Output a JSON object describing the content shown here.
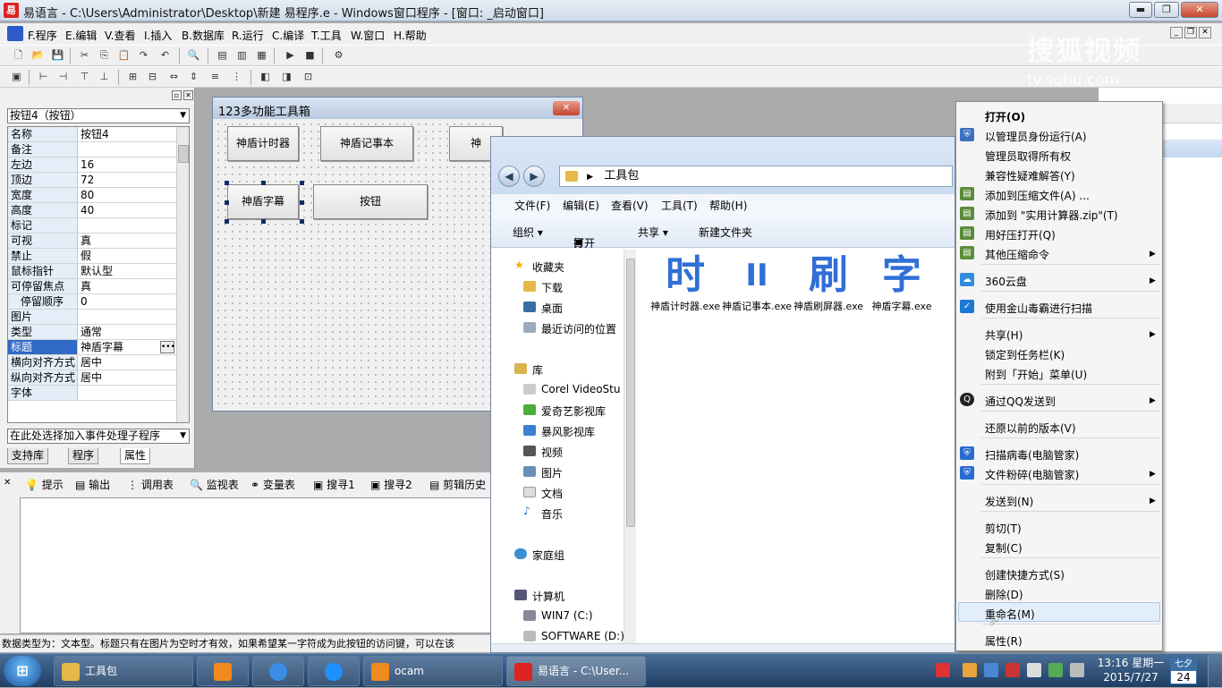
{
  "window": {
    "title": "易语言 - C:\\Users\\Administrator\\Desktop\\新建 易程序.e - Windows窗口程序 - [窗口: _启动窗口]",
    "min": "▬",
    "max": "❐",
    "close": "✕"
  },
  "menubar": [
    "F.程序",
    "E.编辑",
    "V.查看",
    "I.插入",
    "B.数据库",
    "R.运行",
    "C.编译",
    "T.工具",
    "W.窗口",
    "H.帮助"
  ],
  "properties": {
    "object": "按钮4（按钮）",
    "rows": [
      {
        "name": "名称",
        "value": "按钮4"
      },
      {
        "name": "备注",
        "value": ""
      },
      {
        "name": "左边",
        "value": "16"
      },
      {
        "name": "顶边",
        "value": "72"
      },
      {
        "name": "宽度",
        "value": "80"
      },
      {
        "name": "高度",
        "value": "40"
      },
      {
        "name": "标记",
        "value": ""
      },
      {
        "name": "可视",
        "value": "真"
      },
      {
        "name": "禁止",
        "value": "假"
      },
      {
        "name": "鼠标指针",
        "value": "默认型"
      },
      {
        "name": "可停留焦点",
        "value": "真"
      },
      {
        "name": "停留顺序",
        "value": "0"
      },
      {
        "name": "图片",
        "value": ""
      },
      {
        "name": "类型",
        "value": "通常"
      },
      {
        "name": "标题",
        "value": "神盾字幕"
      },
      {
        "name": "横向对齐方式",
        "value": "居中"
      },
      {
        "name": "纵向对齐方式",
        "value": "居中"
      },
      {
        "name": "字体",
        "value": ""
      }
    ],
    "event_select": "在此处选择加入事件处理子程序",
    "tabs": [
      "支持库",
      "程序",
      "属性"
    ]
  },
  "form": {
    "title": "123多功能工具箱",
    "buttons": [
      "神盾计时器",
      "神盾记事本",
      "神",
      "神盾字幕",
      "按钮"
    ]
  },
  "output_tabs": [
    "提示",
    "输出",
    "调用表",
    "监视表",
    "变量表",
    "搜寻1",
    "搜寻2",
    "剪辑历史"
  ],
  "status": "数据类型为：文本型。标题只有在图片为空时才有效，如果希望某一字符成为此按钮的访问键，可以在该",
  "explorer": {
    "address": "工具包",
    "menu": [
      "文件(F)",
      "编辑(E)",
      "查看(V)",
      "工具(T)",
      "帮助(H)"
    ],
    "commands": [
      "组织 ▾",
      "打开",
      "共享 ▾",
      "新建文件夹"
    ],
    "nav": {
      "favorites": "收藏夹",
      "fav_items": [
        "下载",
        "桌面",
        "最近访问的位置"
      ],
      "library": "库",
      "lib_items": [
        "Corel VideoStu",
        "爱奇艺影视库",
        "暴风影视库",
        "视频",
        "图片",
        "文档",
        "音乐"
      ],
      "homegroup": "家庭组",
      "computer": "计算机",
      "drives": [
        "WIN7 (C:)",
        "SOFTWARE (D:)"
      ]
    },
    "files": [
      {
        "glyph": "时",
        "name": "神盾计时器.exe"
      },
      {
        "glyph": "II",
        "name": "神盾记事本.exe"
      },
      {
        "glyph": "刷",
        "name": "神盾刷屏器.exe"
      },
      {
        "glyph": "字",
        "name": "神盾字幕.exe"
      }
    ]
  },
  "context_menu": {
    "items": [
      "打开(O)",
      "以管理员身份运行(A)",
      "管理员取得所有权",
      "兼容性疑难解答(Y)",
      "添加到压缩文件(A) ...",
      "添加到 \"实用计算器.zip\"(T)",
      "用好压打开(Q)",
      "其他压缩命令",
      "360云盘",
      "使用金山毒霸进行扫描",
      "共享(H)",
      "锁定到任务栏(K)",
      "附到「开始」菜单(U)",
      "通过QQ发送到",
      "还原以前的版本(V)",
      "扫描病毒(电脑管家)",
      "文件粉碎(电脑管家)",
      "发送到(N)",
      "剪切(T)",
      "复制(C)",
      "创建快捷方式(S)",
      "删除(D)",
      "重命名(M)",
      "属性(R)"
    ],
    "submenu_arrow": "▶"
  },
  "taskbar": {
    "start": "⊞",
    "buttons": [
      "工具包",
      "ocam",
      "易语言 - C:\\User..."
    ],
    "time": "13:16 星期一",
    "date": "2015/7/27",
    "cal_top": "七夕",
    "cal_day": "24"
  },
  "watermark": {
    "line1": "搜狐视频",
    "line2": "tv.sohu.com"
  },
  "colors": {
    "selection": "#3169c6",
    "accent": "#2f6fd6",
    "taskbar": "#2b4a70"
  }
}
